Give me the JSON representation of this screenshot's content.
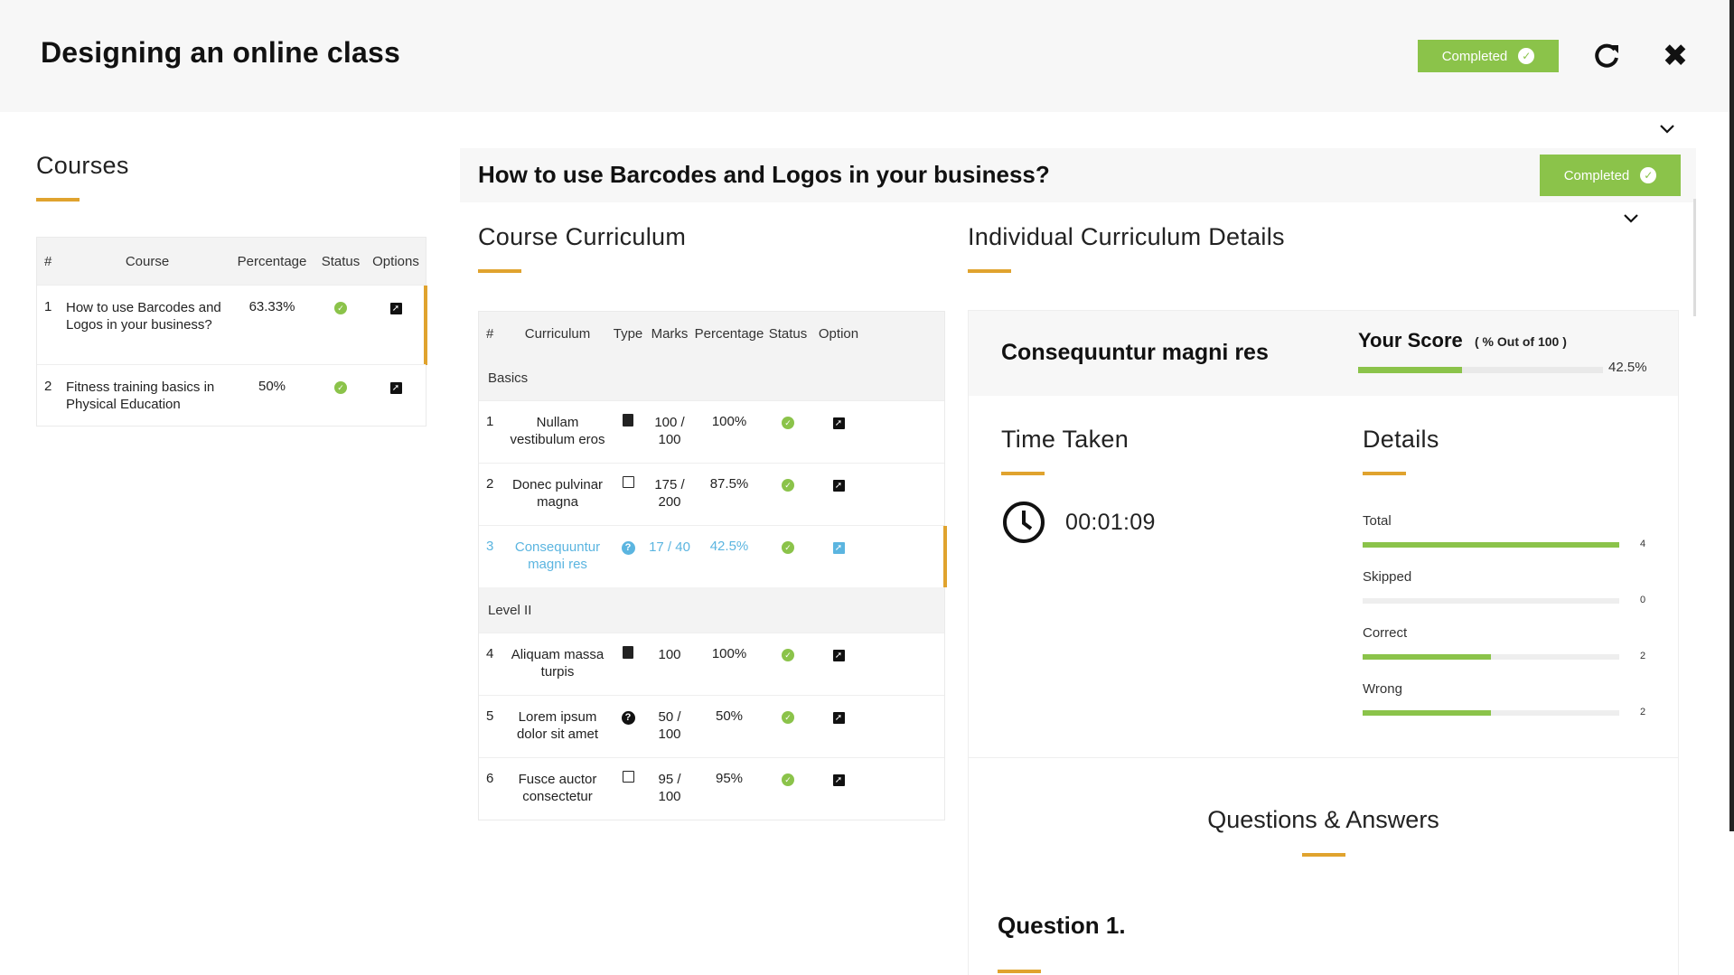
{
  "header": {
    "title": "Designing an online class",
    "completed_label": "Completed"
  },
  "courses": {
    "heading": "Courses",
    "columns": [
      "#",
      "Course",
      "Percentage",
      "Status",
      "Options"
    ],
    "rows": [
      {
        "num": "1",
        "course": "How to use Barcodes and Logos in your business?",
        "percentage": "63.33%"
      },
      {
        "num": "2",
        "course": "Fitness training basics in Physical Education",
        "percentage": "50%"
      }
    ]
  },
  "course_panel": {
    "title": "How to use Barcodes and Logos in your business?",
    "completed_label": "Completed"
  },
  "curriculum": {
    "heading": "Course Curriculum",
    "columns": [
      "#",
      "Curriculum",
      "Type",
      "Marks",
      "Percentage",
      "Status",
      "Option"
    ],
    "groups": [
      {
        "name": "Basics",
        "rows": [
          {
            "num": "1",
            "name": "Nullam vestibulum eros",
            "type_icon": "book-icon",
            "marks": "100 / 100",
            "percentage": "100%"
          },
          {
            "num": "2",
            "name": "Donec pulvinar magna",
            "type_icon": "document-icon",
            "marks": "175 / 200",
            "percentage": "87.5%"
          },
          {
            "num": "3",
            "name": "Consequuntur magni res",
            "type_icon": "question-icon",
            "marks": "17 / 40",
            "percentage": "42.5%"
          }
        ]
      },
      {
        "name": "Level II",
        "rows": [
          {
            "num": "4",
            "name": "Aliquam massa turpis",
            "type_icon": "book-icon",
            "marks": "100",
            "percentage": "100%"
          },
          {
            "num": "5",
            "name": "Lorem ipsum dolor sit amet",
            "type_icon": "question-icon",
            "marks": "50 / 100",
            "percentage": "50%"
          },
          {
            "num": "6",
            "name": "Fusce auctor consectetur",
            "type_icon": "document-icon",
            "marks": "95 / 100",
            "percentage": "95%"
          }
        ]
      }
    ]
  },
  "details": {
    "heading": "Individual Curriculum Details",
    "curriculum_name": "Consequuntur magni res",
    "your_score_label": "Your Score",
    "score_sub": "( % Out of 100 )",
    "score_percent": "42.5%",
    "score_fraction": 0.425,
    "time_heading": "Time Taken",
    "time_value": "00:01:09",
    "details_heading": "Details",
    "stats": [
      {
        "label": "Total",
        "value": "4",
        "fraction": 1.0
      },
      {
        "label": "Skipped",
        "value": "0",
        "fraction": 0.0
      },
      {
        "label": "Correct",
        "value": "2",
        "fraction": 0.5
      },
      {
        "label": "Wrong",
        "value": "2",
        "fraction": 0.5
      }
    ],
    "qa_heading": "Questions & Answers",
    "question_title": "Question 1."
  },
  "colors": {
    "accent": "#e0a32e",
    "success": "#8bc34a",
    "active_link": "#5bb5e0"
  }
}
